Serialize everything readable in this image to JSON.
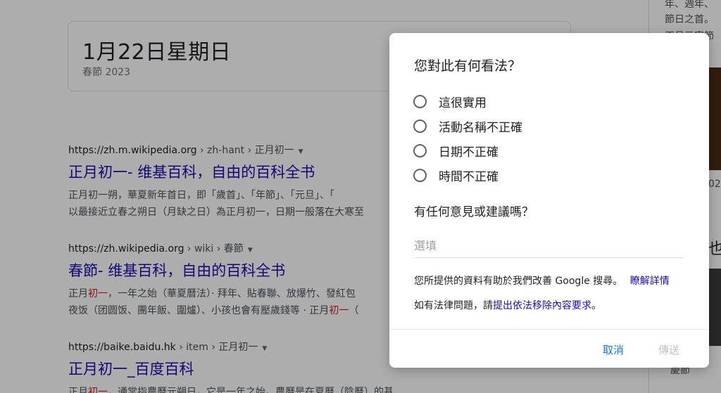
{
  "background": {
    "date_card": {
      "title": "1月22日星期日",
      "subtitle": "春節 2023"
    },
    "results": [
      {
        "site": "https://zh.m.wikipedia.org",
        "path": " › zh-hant › 正月初一",
        "title": "正月初一- 维基百科，自由的百科全书",
        "snippet_line1": "正月初一朔，華夏新年首日，即「歲首」、「年節」、「元旦」、「",
        "snippet_line2": "以最接近立春之朔日（月缺之日）為正月初一，日期一般落在大寒至"
      },
      {
        "site": "https://zh.wikipedia.org",
        "path": " › wiki › 春節",
        "title": "春節- 维基百科，自由的百科全书",
        "snippet_line1_pre": "正月",
        "snippet_line1_hl": "初一",
        "snippet_line1_post": "，一年之始（華夏曆法）· 拜年、貼春聯、放爆竹、發紅包",
        "snippet_line2_pre": "夜饭（团圆饭、團年飯、圍爐）、小孩也會有壓歲錢等 · 正月",
        "snippet_line2_hl": "初一",
        "snippet_line2_post": "（"
      },
      {
        "site": "https://baike.baidu.hk",
        "path": " › item › 正月初一",
        "title": "正月初一_百度百科",
        "snippet_line1_pre": "正月",
        "snippet_line1_hl": "初一",
        "snippet_line1_post": "，通常指農曆元朔日，它是一年之始。農曆是在夏曆（陰曆）的基礎上融合陽曆成分從"
      }
    ],
    "right_col": {
      "line1": "年、週年、",
      "line2": "節日之首。",
      "line3": "正月元宵節",
      "line4": "時到",
      "big1": "也",
      "side1": "023",
      "side2": "慶節"
    }
  },
  "dialog": {
    "heading": "您對此有何看法？",
    "options": [
      "這很實用",
      "活動名稱不正確",
      "日期不正確",
      "時間不正確"
    ],
    "sub_heading": "有任何意見或建議嗎？",
    "comment_placeholder": "選填",
    "info_text": "您所提供的資料有助於我們改善 Google 搜尋。",
    "info_link": "瞭解詳情",
    "legal_text": "如有法律問題，請",
    "legal_link": "提出依法移除內容要求",
    "legal_suffix": "。",
    "cancel_label": "取消",
    "send_label": "傳送"
  },
  "colors": {
    "link": "#1a0dab",
    "accent": "#1a73e8",
    "overlay": "rgba(0,0,0,0.32)"
  }
}
